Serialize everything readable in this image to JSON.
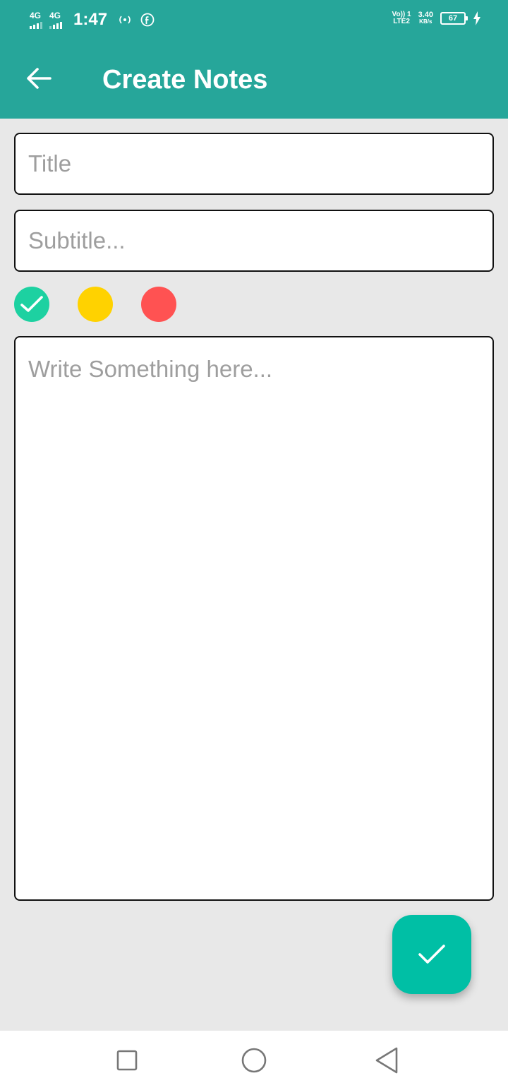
{
  "status_bar": {
    "network1": "4G",
    "network2": "4G",
    "time": "1:47",
    "volte_top": "Vo)) 1",
    "volte_bottom": "LTE2",
    "speed_value": "3.40",
    "speed_unit": "KB/s",
    "battery": "67",
    "icons": [
      "signal-icon",
      "hotspot-icon",
      "facebook-icon",
      "battery-icon",
      "charging-icon"
    ]
  },
  "app_bar": {
    "title": "Create Notes",
    "back_icon": "arrow-left-icon",
    "color": "#26a69a"
  },
  "form": {
    "title_placeholder": "Title",
    "title_value": "",
    "subtitle_placeholder": "Subtitle...",
    "subtitle_value": "",
    "body_placeholder": "Write Something here...",
    "body_value": ""
  },
  "priority_colors": [
    {
      "name": "green",
      "color": "#1dd1a1",
      "selected": true
    },
    {
      "name": "yellow",
      "color": "#ffd200",
      "selected": false
    },
    {
      "name": "red",
      "color": "#ff5252",
      "selected": false
    }
  ],
  "fab": {
    "icon": "check-icon",
    "color": "#00bfa5"
  },
  "nav_bar": {
    "icons": [
      "recents-square-icon",
      "home-circle-icon",
      "back-triangle-icon"
    ]
  }
}
